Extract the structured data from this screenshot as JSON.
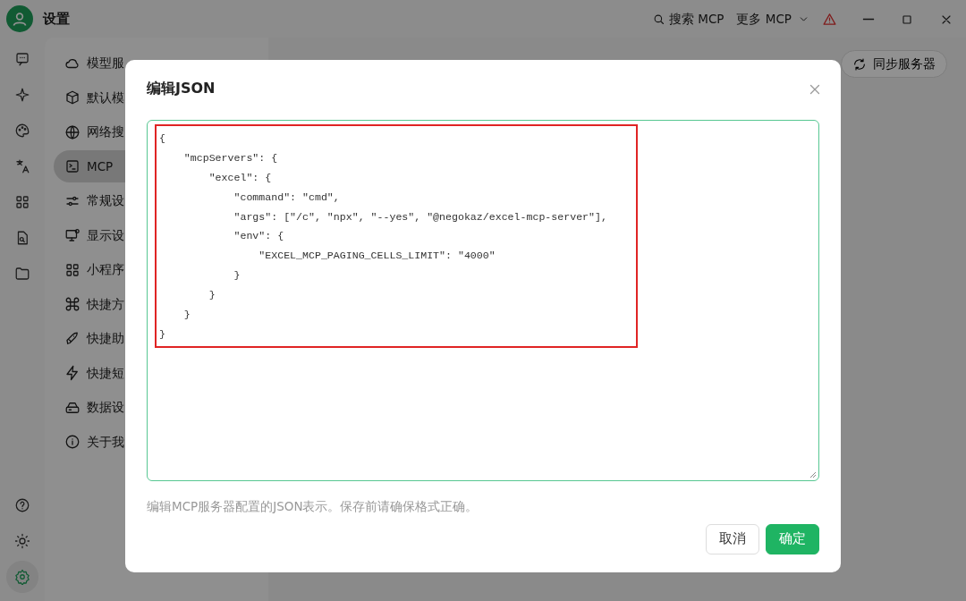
{
  "window": {
    "title": "设置"
  },
  "top_bar": {
    "search": "搜索 MCP",
    "more": "更多 MCP"
  },
  "rail": {
    "top": [
      {
        "selected": false
      },
      {
        "selected": false
      },
      {
        "selected": false
      },
      {
        "selected": false
      },
      {
        "selected": false
      },
      {
        "selected": false
      },
      {
        "selected": false
      }
    ],
    "bottom": [
      {
        "selected": false
      },
      {
        "selected": false
      },
      {
        "selected": true
      }
    ]
  },
  "sidebar": {
    "items": [
      {
        "label": "模型服",
        "selected": false
      },
      {
        "label": "默认模",
        "selected": false
      },
      {
        "label": "网络搜",
        "selected": false
      },
      {
        "label": "MCP",
        "selected": true
      },
      {
        "label": "常规设",
        "selected": false
      },
      {
        "label": "显示设",
        "selected": false
      },
      {
        "label": "小程序",
        "selected": false
      },
      {
        "label": "快捷方",
        "selected": false
      },
      {
        "label": "快捷助",
        "selected": false
      },
      {
        "label": "快捷短",
        "selected": false
      },
      {
        "label": "数据设",
        "selected": false
      },
      {
        "label": "关于我",
        "selected": false
      }
    ]
  },
  "content": {
    "sync_button": "同步服务器"
  },
  "dialog": {
    "title": "编辑JSON",
    "editor": {
      "lines": [
        "{",
        "    \"mcpServers\": {",
        "        \"excel\": {",
        "            \"command\": \"cmd\",",
        "            \"args\": [\"/c\", \"npx\", \"--yes\", \"@negokaz/excel-mcp-server\"],",
        "            \"env\": {",
        "                \"EXCEL_MCP_PAGING_CELLS_LIMIT\": \"4000\"",
        "            }",
        "        }",
        "    }",
        "}"
      ],
      "highlighted": true
    },
    "hint": "编辑MCP服务器配置的JSON表示。保存前请确保格式正确。",
    "buttons": [
      {
        "label": "取消",
        "kind": "secondary"
      },
      {
        "label": "确定",
        "kind": "primary"
      }
    ]
  }
}
